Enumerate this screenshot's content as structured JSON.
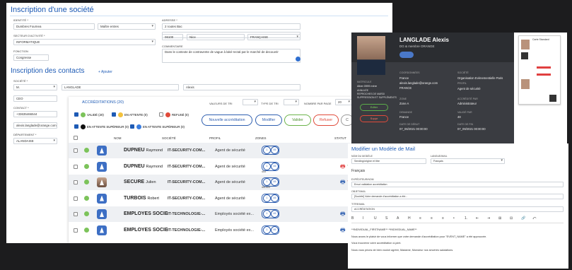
{
  "main": {
    "title": "Inscription d'une société",
    "fields": {
      "identite_label": "IDENTITÉ *",
      "identite_value": "Dumbres Fournea",
      "identite_select": "Maître entres",
      "adresse_label": "ADRESSE *",
      "adresse_value": "2 routes Bac",
      "adresse2_value": "",
      "cp_value": "06100",
      "ville_value": "Nice",
      "pays_value": "FRANÇAISE",
      "secteur_label": "SECTEUR D'ACTIVITÉ *",
      "secteur_value": "INFORMATIQUE",
      "fonction_label": "FONCTION",
      "fonction_value": "Congresse",
      "commentaire_label": "COMMENTAIRE",
      "commentaire_value": "Dans le contexte de contravente de vague à laké-rectal par le marché de decouvrir"
    },
    "contacts_title": "Inscription des contacts",
    "add_label": "+ Ajouter",
    "contact_fields": {
      "societe_label": "SOCIÉTÉ *",
      "civ_value": "M.",
      "nom_value": "LANGLADE",
      "prenom_value": "Alexis",
      "poste_value": "CEO",
      "contact_label": "CONTACT *",
      "tel_value": "+33635466544",
      "email_value": "alexis.langlade@orange.com",
      "dept_label": "DÉPARTEMENT *",
      "dept_value": "ALANDAISE"
    },
    "accreditations": "ACCRÉDITATIONS (20)",
    "filters": {
      "valeurs_label": "VALEURS DE TRI",
      "type_label": "TYPE DE TRI",
      "page_label": "NOMBRE PAR PAGE",
      "page_value": "20"
    },
    "legend": {
      "valide": "VALIDÉ (20)",
      "attente": "EN ATTENTE (0)",
      "refuse": "REFUSÉ (0)",
      "attente_sup1": "EN ATTENTE SUPÉRIEUR (0)",
      "attente_sup2": "EN ATTENTE SUPÉRIEUR (0)"
    },
    "buttons": {
      "nouvelle": "Nouvelle accréditation",
      "modifier": "Modifier",
      "valider": "Valider",
      "refuser": "Refuser",
      "c": "C"
    },
    "columns": [
      "NOM",
      "SOCIÉTÉ",
      "PROFIL",
      "ZONES",
      "STATUT"
    ],
    "rows": [
      {
        "name": "DUPNEU",
        "first": "Raymond",
        "company": "IT-SECURITY-COM...",
        "profile": "Agent de sécurité",
        "zones": "",
        "photo": false
      },
      {
        "name": "DUPNEU",
        "first": "Raymond",
        "company": "IT-SECURITY-COM...",
        "profile": "Agent de sécurité",
        "zones": "403",
        "photo": false
      },
      {
        "name": "SECURE",
        "first": "Julien",
        "company": "IT-SECURITY-COM...",
        "profile": "Agent de sécurité",
        "zones": "401403",
        "photo": true
      },
      {
        "name": "TURBOIS",
        "first": "Robert",
        "company": "IT-SECURITY-COM...",
        "profile": "Agent de sécurité",
        "zones": "",
        "photo": false
      },
      {
        "name": "EMPLOYÉS SOCIÉT",
        "first": "",
        "company": "IT-TECHNOLOGIE-...",
        "profile": "Employés société ex...",
        "zones": "",
        "photo": false
      },
      {
        "name": "EMPLOYÉS SOCIÉT",
        "first": "",
        "company": "IT-TECHNOLOGIE-...",
        "profile": "Employés société ex...",
        "zones": "",
        "photo": false
      }
    ],
    "zone_a": "1",
    "zone_b": "45"
  },
  "profile": {
    "name": "LANGLADE Alexis",
    "company": "DG & membre ORANGE",
    "coordonnees_label": "COORDONNÉES",
    "phone": "France",
    "email": "alexis.langlade@orange.com",
    "country": "FRANCE",
    "societe_label": "SOCIÉTÉ",
    "societe_value": "Organisation Evènementielle Paris",
    "profil_label": "PROFIL",
    "profil_value": "Agent de sécurité",
    "matricule_label": "MATRICULE",
    "matricule_value": "Alber 0999 mère",
    "dept_lines": [
      "ANNULÉE",
      "REPROCHES DE MARDI",
      "SUPPRESSION ET SUPPLÉMENTS"
    ],
    "zone_label": "ZONE",
    "zone_value": "Zone A",
    "accred_label": "ACCRÉDITÉ PAR",
    "accred_value": "Administrateur",
    "valide_label": "VALIDÉ PAR",
    "valide_value": "48",
    "debut_label": "DATE DE DÉBUT",
    "debut_value": "07_06/2021 00:00:00",
    "fin_label": "DATE DE FIN",
    "fin_value": "07_09/2021 00:00:00",
    "demande_label": "DEMANDE",
    "demande_value": "France",
    "modif_label": "DATE MODIFICATION",
    "modif_value": "07/07/2021 10:00:00",
    "btn_edit": "Editer",
    "btn_delete": "Suppr",
    "card_title": "Carte Standard",
    "accent": "#e04040"
  },
  "mail": {
    "title": "Modifier un Modèle de Mail",
    "nom_label": "NOM DU MODÈLE",
    "nom_value": "Sending/origine et titre",
    "langue_label": "LANGUE/MAIL",
    "langue_value": "Français",
    "lang_heading": "Français",
    "expediteur_label": "EXPÉDITEUR/NOM",
    "expediteur_value": "Envoi validation accréditation",
    "objet_label": "OBJET/MAIL",
    "objet_value": "[Société] Votre demande d'accréditation a été...",
    "titre_label": "TITRE/MAIL",
    "titre_value": "ACCRÉDITATION",
    "toolbar": [
      "B",
      "I",
      "U",
      "S",
      "A",
      "H",
      "≡",
      "≡",
      "≡",
      "•",
      "1.",
      "⇤",
      "⇥",
      "⊞",
      "⊟",
      "🔗",
      "⤺"
    ],
    "body_lines": [
      "**INDIVIDUAL_FIRSTNAME** **INDIVIDUAL_NAME**",
      "Nous avons le plaisir de vous informer que votre demande d'accréditation pour \"EVENT_NAME\" a été approuvée.",
      "Vous trouverez votre accréditation ci-joint.",
      "Nous vous prions de bien vouloir agréer, Madame, Monsieur nos sincères salutations."
    ]
  }
}
